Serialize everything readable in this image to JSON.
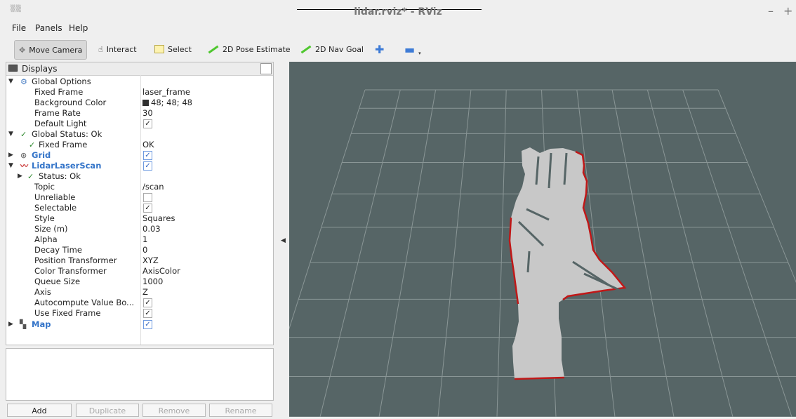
{
  "window": {
    "title": "lidar.rviz* - RViz",
    "minimize": "–",
    "maximize": "+"
  },
  "menu": [
    "File",
    "Panels",
    "Help"
  ],
  "toolbar": {
    "move_camera": "Move Camera",
    "interact": "Interact",
    "select": "Select",
    "pose_estimate": "2D Pose Estimate",
    "nav_goal": "2D Nav Goal"
  },
  "displays": {
    "title": "Displays",
    "rows": {
      "global_options": "Global Options",
      "fixed_frame": {
        "name": "Fixed Frame",
        "value": "laser_frame"
      },
      "background_color": {
        "name": "Background Color",
        "value": "48; 48; 48"
      },
      "frame_rate": {
        "name": "Frame Rate",
        "value": "30"
      },
      "default_light": {
        "name": "Default Light",
        "checked": true
      },
      "global_status": "Global Status: Ok",
      "status_fixed_frame": {
        "name": "Fixed Frame",
        "value": "OK"
      },
      "grid": {
        "name": "Grid",
        "checked": true
      },
      "lidar": {
        "name": "LidarLaserScan",
        "checked": true
      },
      "lidar_status": "Status: Ok",
      "topic": {
        "name": "Topic",
        "value": "/scan"
      },
      "unreliable": {
        "name": "Unreliable",
        "checked": false
      },
      "selectable": {
        "name": "Selectable",
        "checked": true
      },
      "style": {
        "name": "Style",
        "value": "Squares"
      },
      "size": {
        "name": "Size (m)",
        "value": "0.03"
      },
      "alpha": {
        "name": "Alpha",
        "value": "1"
      },
      "decay_time": {
        "name": "Decay Time",
        "value": "0"
      },
      "position_transformer": {
        "name": "Position Transformer",
        "value": "XYZ"
      },
      "color_transformer": {
        "name": "Color Transformer",
        "value": "AxisColor"
      },
      "queue_size": {
        "name": "Queue Size",
        "value": "1000"
      },
      "axis": {
        "name": "Axis",
        "value": "Z"
      },
      "autocompute": {
        "name": "Autocompute Value Bo...",
        "checked": true
      },
      "use_fixed_frame": {
        "name": "Use Fixed Frame",
        "checked": true
      },
      "map": {
        "name": "Map",
        "checked": true
      }
    }
  },
  "buttons": {
    "add": "Add",
    "duplicate": "Duplicate",
    "remove": "Remove",
    "rename": "Rename"
  },
  "colors": {
    "viewport_bg": "#566566",
    "grid_line": "#8a9696",
    "scan_fill": "#c8c8c8",
    "scan_edge": "#c01818",
    "accent_blue": "#3273c8"
  }
}
